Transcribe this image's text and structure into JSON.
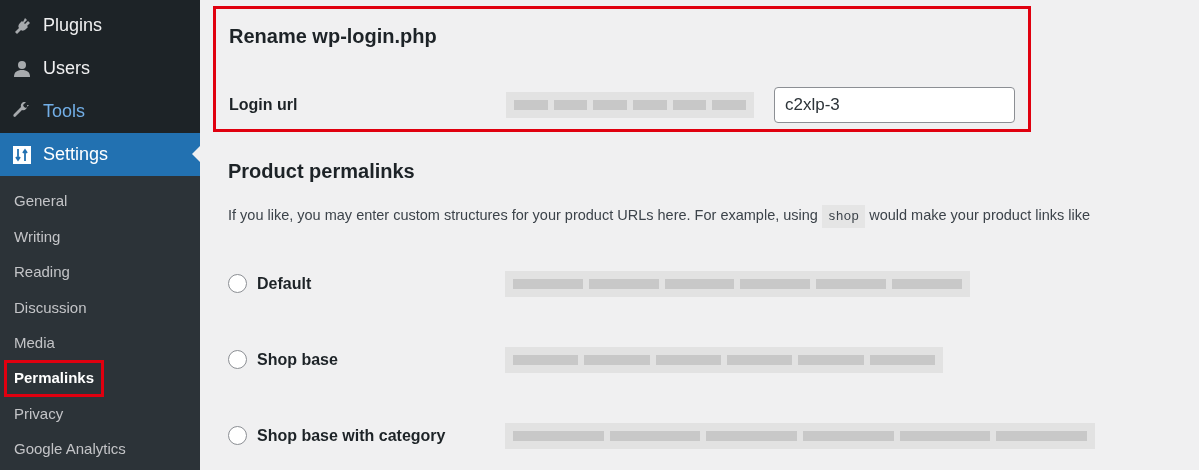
{
  "sidebar": {
    "menu": [
      {
        "label": "Plugins",
        "kind": "plug",
        "selected": false,
        "hover": false
      },
      {
        "label": "Users",
        "kind": "user",
        "selected": false,
        "hover": false
      },
      {
        "label": "Tools",
        "kind": "wrench",
        "selected": false,
        "hover": true
      },
      {
        "label": "Settings",
        "kind": "sliders",
        "selected": true,
        "hover": false
      }
    ],
    "submenu": [
      {
        "label": "General",
        "selected": false,
        "highlighted": false
      },
      {
        "label": "Writing",
        "selected": false,
        "highlighted": false
      },
      {
        "label": "Reading",
        "selected": false,
        "highlighted": false
      },
      {
        "label": "Discussion",
        "selected": false,
        "highlighted": false
      },
      {
        "label": "Media",
        "selected": false,
        "highlighted": false
      },
      {
        "label": "Permalinks",
        "selected": true,
        "highlighted": true
      },
      {
        "label": "Privacy",
        "selected": false,
        "highlighted": false
      },
      {
        "label": "Google Analytics",
        "selected": false,
        "highlighted": false
      }
    ]
  },
  "rename_section": {
    "title": "Rename wp-login.php",
    "highlighted": true,
    "label": "Login url",
    "value": "c2xlp-3"
  },
  "product_permalinks": {
    "title": "Product permalinks",
    "description_before": "If you like, you may enter custom structures for your product URLs here. For example, using",
    "code": "shop",
    "description_after": "would make your product links like",
    "options": [
      {
        "label": "Default",
        "selected": false
      },
      {
        "label": "Shop base",
        "selected": false
      },
      {
        "label": "Shop base with category",
        "selected": false
      }
    ]
  }
}
